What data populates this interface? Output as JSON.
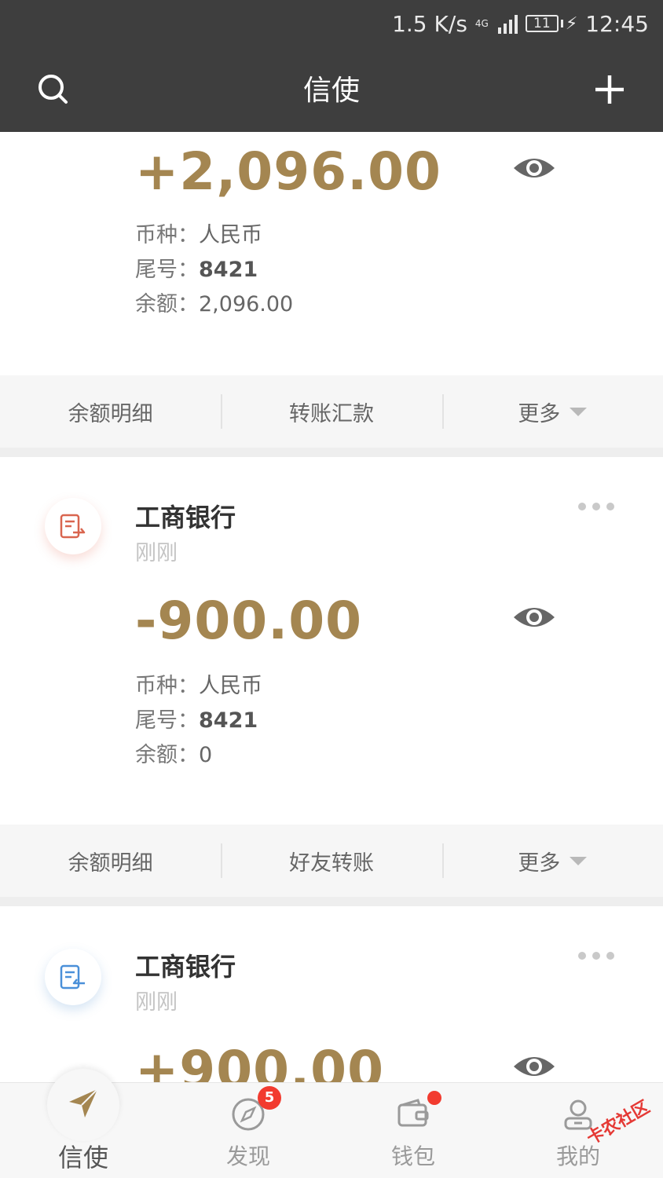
{
  "status_bar": {
    "speed": "1.5 K/s",
    "network": "4G",
    "battery": "11",
    "time": "12:45"
  },
  "header": {
    "title": "信使",
    "search_icon": "search-icon",
    "add_icon": "plus-icon"
  },
  "cards": [
    {
      "amount": "+2,096.00",
      "labels": {
        "currency": "币种：",
        "tail": "尾号：",
        "balance": "余额："
      },
      "currency": "人民币",
      "tail": "8421",
      "balance": "2,096.00",
      "actions": [
        "余额明细",
        "转账汇款",
        "更多"
      ]
    },
    {
      "bank": "工商银行",
      "time": "刚刚",
      "icon": "transfer-out-icon",
      "amount": "-900.00",
      "labels": {
        "currency": "币种：",
        "tail": "尾号：",
        "balance": "余额："
      },
      "currency": "人民币",
      "tail": "8421",
      "balance": "0",
      "actions": [
        "余额明细",
        "好友转账",
        "更多"
      ]
    },
    {
      "bank": "工商银行",
      "time": "刚刚",
      "icon": "transfer-in-icon",
      "amount": "+900.00"
    }
  ],
  "tabbar": {
    "tabs": [
      {
        "label": "信使",
        "icon": "paper-plane-icon",
        "active": true
      },
      {
        "label": "发现",
        "icon": "compass-icon",
        "badge": "5"
      },
      {
        "label": "钱包",
        "icon": "wallet-icon",
        "dot": true
      },
      {
        "label": "我的",
        "icon": "user-icon"
      }
    ]
  },
  "watermark": "卡农社区",
  "colors": {
    "header": "#3e3e3e",
    "amount": "#a48651",
    "badge": "#f23b2f"
  }
}
